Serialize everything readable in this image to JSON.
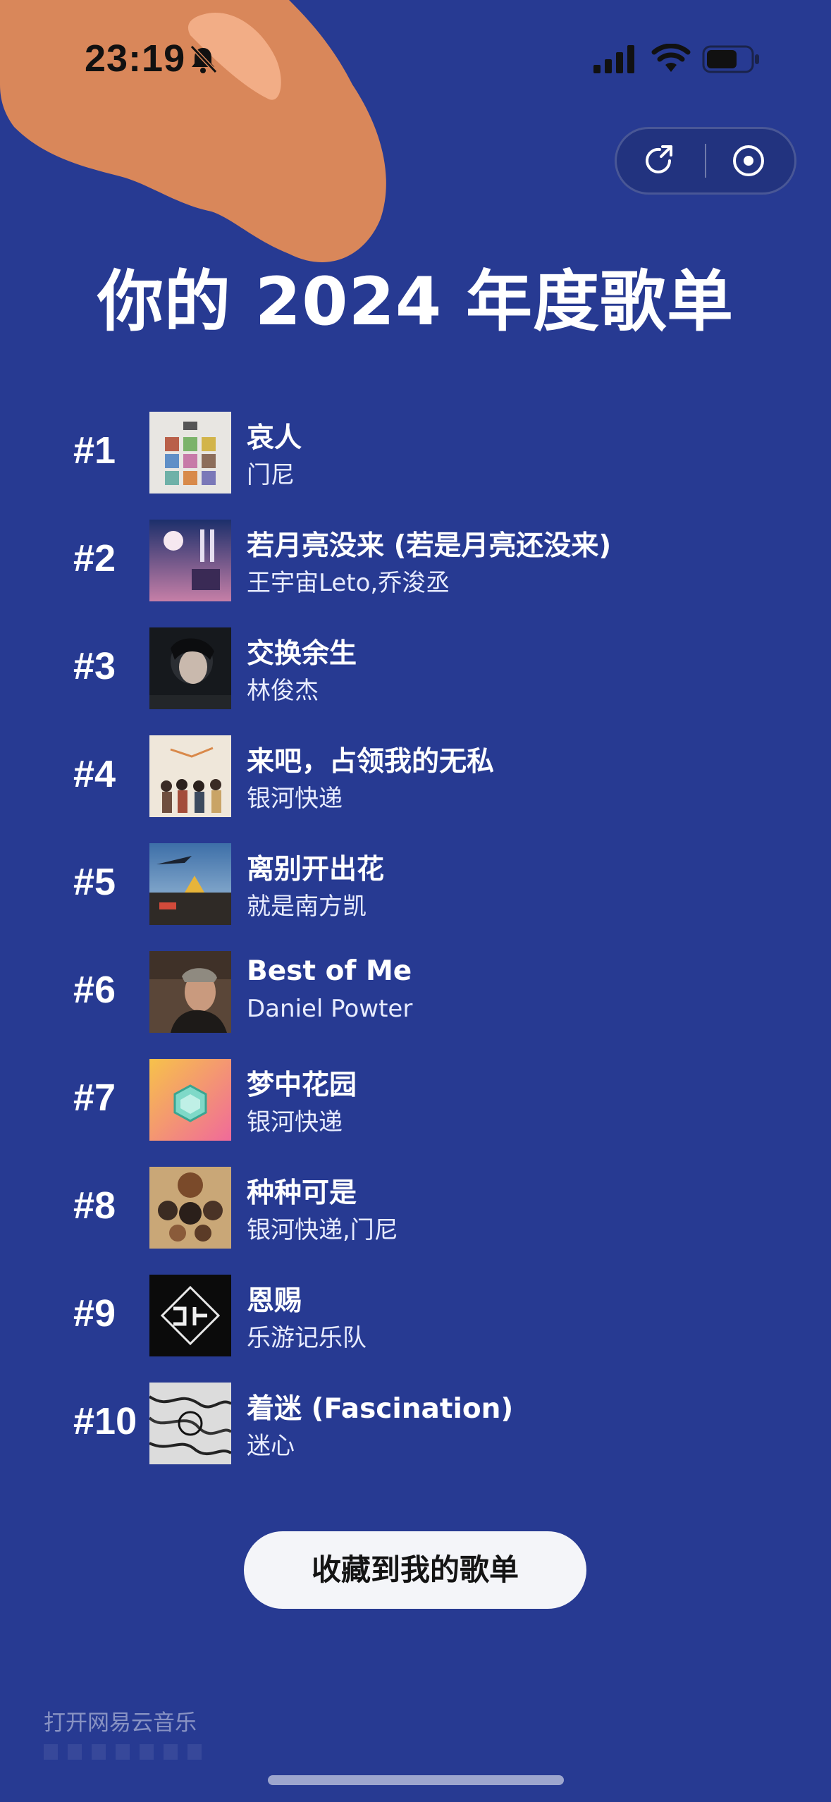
{
  "status_bar": {
    "time": "23:19"
  },
  "page": {
    "title": "你的 2024 年度歌单"
  },
  "songs": [
    {
      "rank": "#1",
      "title": "哀人",
      "artist": "门尼"
    },
    {
      "rank": "#2",
      "title": "若月亮没来 (若是月亮还没来)",
      "artist": "王宇宙Leto,乔浚丞"
    },
    {
      "rank": "#3",
      "title": "交换余生",
      "artist": "林俊杰"
    },
    {
      "rank": "#4",
      "title": "来吧，占领我的无私",
      "artist": "银河快递"
    },
    {
      "rank": "#5",
      "title": "离别开出花",
      "artist": "就是南方凯"
    },
    {
      "rank": "#6",
      "title": "Best of Me",
      "artist": "Daniel Powter"
    },
    {
      "rank": "#7",
      "title": "梦中花园",
      "artist": "银河快递"
    },
    {
      "rank": "#8",
      "title": "种种可是",
      "artist": "银河快递,门尼"
    },
    {
      "rank": "#9",
      "title": "恩赐",
      "artist": "乐游记乐队"
    },
    {
      "rank": "#10",
      "title": "着迷 (Fascination)",
      "artist": "迷心"
    }
  ],
  "actions": {
    "save_label": "收藏到我的歌单"
  },
  "footer": {
    "open_app": "打开网易云音乐"
  },
  "colors": {
    "background": "#273a92",
    "blob": "#d9875a",
    "button": "#f4f5f9"
  }
}
